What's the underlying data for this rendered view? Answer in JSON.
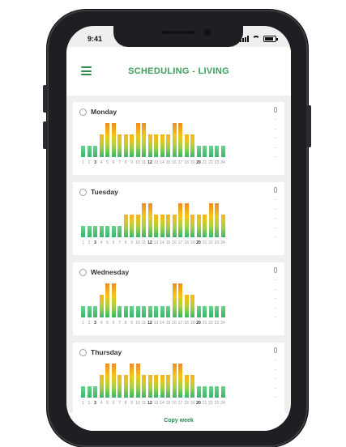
{
  "status": {
    "time": "9:41"
  },
  "header": {
    "title": "SCHEDULING - LIVING",
    "menu_icon": "menu-icon"
  },
  "colors": {
    "accent": "#3aa15a",
    "low": "#38b56a",
    "mid": "#e8c51f",
    "high": "#f08a24"
  },
  "hour_labels": [
    "1",
    "2",
    "3",
    "4",
    "5",
    "6",
    "7",
    "8",
    "9",
    "10",
    "11",
    "12",
    "13",
    "14",
    "15",
    "16",
    "17",
    "18",
    "19",
    "20",
    "21",
    "22",
    "23",
    "24"
  ],
  "days": [
    {
      "name": "Monday",
      "levels": [
        1,
        1,
        1,
        2,
        3,
        3,
        2,
        2,
        2,
        3,
        3,
        2,
        2,
        2,
        2,
        3,
        3,
        2,
        2,
        1,
        1,
        1,
        1,
        1
      ]
    },
    {
      "name": "Tuesday",
      "levels": [
        1,
        1,
        1,
        1,
        1,
        1,
        1,
        2,
        2,
        2,
        3,
        3,
        2,
        2,
        2,
        2,
        3,
        3,
        2,
        2,
        2,
        3,
        3,
        2
      ]
    },
    {
      "name": "Wednesday",
      "levels": [
        1,
        1,
        1,
        2,
        3,
        3,
        1,
        1,
        1,
        1,
        1,
        1,
        1,
        1,
        1,
        3,
        3,
        2,
        2,
        1,
        1,
        1,
        1,
        1
      ]
    },
    {
      "name": "Thursday",
      "levels": [
        1,
        1,
        1,
        2,
        3,
        3,
        2,
        2,
        3,
        3,
        2,
        2,
        2,
        2,
        2,
        3,
        3,
        2,
        2,
        1,
        1,
        1,
        1,
        1
      ]
    }
  ],
  "footer": {
    "copy_label": "Copy week"
  }
}
